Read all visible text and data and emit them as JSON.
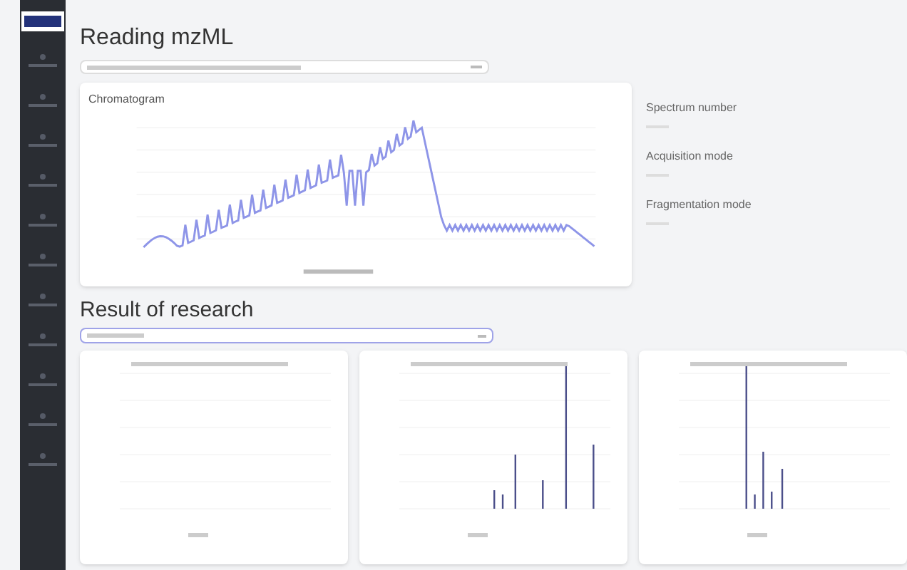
{
  "sidebar": {
    "items": [
      {
        "selected": false
      },
      {
        "selected": false
      },
      {
        "selected": false
      },
      {
        "selected": false
      },
      {
        "selected": false
      },
      {
        "selected": false
      },
      {
        "selected": false
      },
      {
        "selected": false
      },
      {
        "selected": false
      },
      {
        "selected": false
      },
      {
        "selected": false
      }
    ]
  },
  "reading": {
    "title": "Reading mzML",
    "chromatogram": {
      "title": "Chromatogram"
    },
    "info": [
      {
        "label": "Spectrum number"
      },
      {
        "label": "Acquisition mode"
      },
      {
        "label": "Fragmentation mode"
      }
    ]
  },
  "results": {
    "title": "Result of research",
    "spectra": [
      {
        "kind": "empty"
      },
      {
        "kind": "sticks"
      },
      {
        "kind": "sticks"
      }
    ]
  }
}
